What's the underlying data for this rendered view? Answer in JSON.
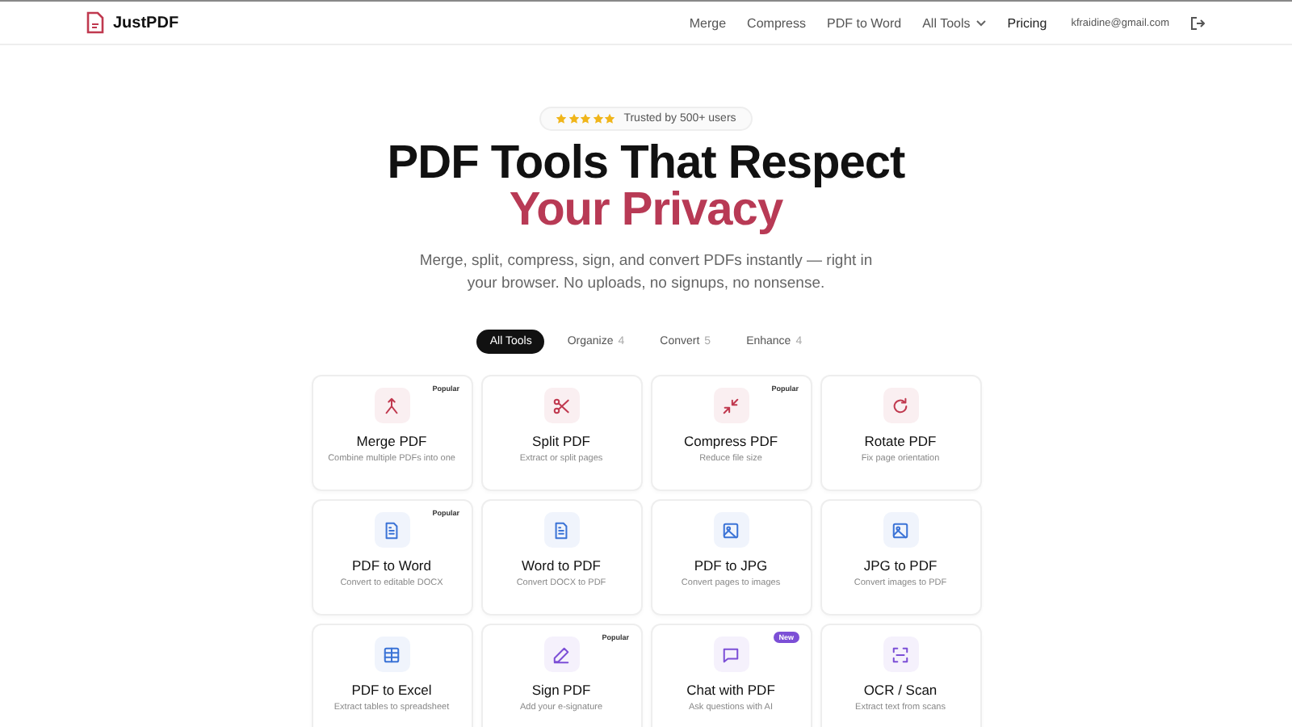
{
  "header": {
    "logo": "JustPDF",
    "nav": [
      "Merge",
      "Compress",
      "PDF to Word"
    ],
    "dropdown": "All Tools",
    "pricing": "Pricing",
    "email": "kfraidine@gmail.com"
  },
  "hero": {
    "stars": 5,
    "trust": "Trusted by 500+ users",
    "title": "PDF Tools That Respect",
    "title_accent": "Your Privacy",
    "subtitle": "Merge, split, compress, sign, and convert PDFs instantly — right in your browser. No uploads, no signups, no nonsense."
  },
  "tabs": [
    {
      "label": "All Tools",
      "selected": true
    },
    {
      "label": "Organize",
      "count": "4",
      "selected": false
    },
    {
      "label": "Convert",
      "count": "5",
      "selected": false
    },
    {
      "label": "Enhance",
      "count": "4",
      "selected": false
    }
  ],
  "tools": [
    {
      "kind": "merge",
      "color": "#c0394f",
      "title": "Merge PDF",
      "desc": "Combine multiple PDFs into one",
      "badge": {
        "text": "Popular",
        "kind": "plain"
      }
    },
    {
      "kind": "split",
      "color": "#c0394f",
      "title": "Split PDF",
      "desc": "Extract or split pages"
    },
    {
      "kind": "compress",
      "color": "#c0394f",
      "title": "Compress PDF",
      "desc": "Reduce file size",
      "badge": {
        "text": "Popular",
        "kind": "plain"
      }
    },
    {
      "kind": "rotate",
      "color": "#c0394f",
      "title": "Rotate PDF",
      "desc": "Fix page orientation"
    },
    {
      "kind": "document",
      "color": "#3b73d6",
      "title": "PDF to Word",
      "desc": "Convert to editable DOCX",
      "badge": {
        "text": "Popular",
        "kind": "plain"
      }
    },
    {
      "kind": "document",
      "color": "#3b73d6",
      "title": "Word to PDF",
      "desc": "Convert DOCX to PDF"
    },
    {
      "kind": "image",
      "color": "#3b73d6",
      "title": "PDF to JPG",
      "desc": "Convert pages to images"
    },
    {
      "kind": "image",
      "color": "#3b73d6",
      "title": "JPG to PDF",
      "desc": "Convert images to PDF"
    },
    {
      "kind": "table",
      "color": "#3b73d6",
      "title": "PDF to Excel",
      "desc": "Extract tables to spreadsheet"
    },
    {
      "kind": "pen",
      "color": "#7c4fd6",
      "title": "Sign PDF",
      "desc": "Add your e-signature",
      "badge": {
        "text": "Popular",
        "kind": "plain"
      }
    },
    {
      "kind": "chat",
      "color": "#7c4fd6",
      "title": "Chat with PDF",
      "desc": "Ask questions with AI",
      "badge": {
        "text": "New",
        "kind": "new"
      }
    },
    {
      "kind": "scan",
      "color": "#7c4fd6",
      "title": "OCR / Scan",
      "desc": "Extract text from scans"
    }
  ]
}
